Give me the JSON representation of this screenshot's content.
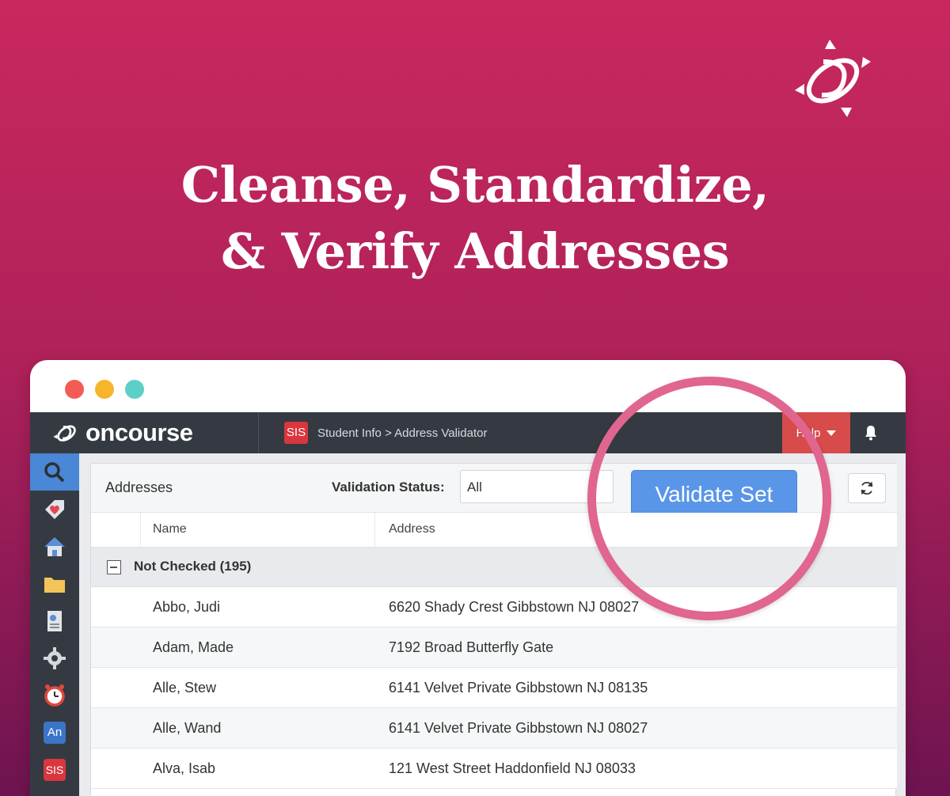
{
  "hero": {
    "line1": "Cleanse, Standardize,",
    "line2": "& Verify Addresses"
  },
  "colors": {
    "background_top": "#c8285e",
    "background_bottom": "#6e1450",
    "accent_blue": "#5a96e8",
    "highlight_ring": "#e0658f",
    "topbar": "#353a42"
  },
  "window": {
    "controls": [
      "close-dot",
      "minimize-dot",
      "zoom-dot"
    ],
    "control_colors": [
      "#f25c54",
      "#f7b52c",
      "#5ccfc7"
    ]
  },
  "app": {
    "logo": "oncourse",
    "module_badge": "SIS",
    "breadcrumb": "Student Info > Address Validator",
    "help_label": "Help",
    "bell_icon": "bell-icon"
  },
  "sidebar": {
    "items": [
      {
        "icon": "search-icon",
        "active": true
      },
      {
        "icon": "heart-tag-icon"
      },
      {
        "icon": "home-icon"
      },
      {
        "icon": "folder-icon"
      },
      {
        "icon": "report-icon"
      },
      {
        "icon": "gear-icon"
      },
      {
        "icon": "alarm-clock-icon"
      },
      {
        "icon": "analytics-icon",
        "label": "An"
      },
      {
        "icon": "sis-icon",
        "label": "SIS"
      }
    ]
  },
  "panel": {
    "title": "Addresses",
    "filter_label": "Validation Status:",
    "filter_value": "All",
    "validate_button": "Validate Set",
    "refresh_icon": "refresh-icon",
    "columns": [
      "Name",
      "Address"
    ],
    "group": "Not Checked (195)",
    "rows": [
      {
        "name": "Abbo, Judi",
        "address": "6620 Shady Crest Gibbstown NJ 08027"
      },
      {
        "name": "Adam, Made",
        "address": "7192 Broad Butterfly Gate"
      },
      {
        "name": "Alle, Stew",
        "address": "6141 Velvet Private Gibbstown NJ 08135"
      },
      {
        "name": "Alle, Wand",
        "address": "6141 Velvet Private Gibbstown NJ 08027"
      },
      {
        "name": "Alva, Isab",
        "address": "121 West Street Haddonfield NJ 08033"
      }
    ]
  }
}
